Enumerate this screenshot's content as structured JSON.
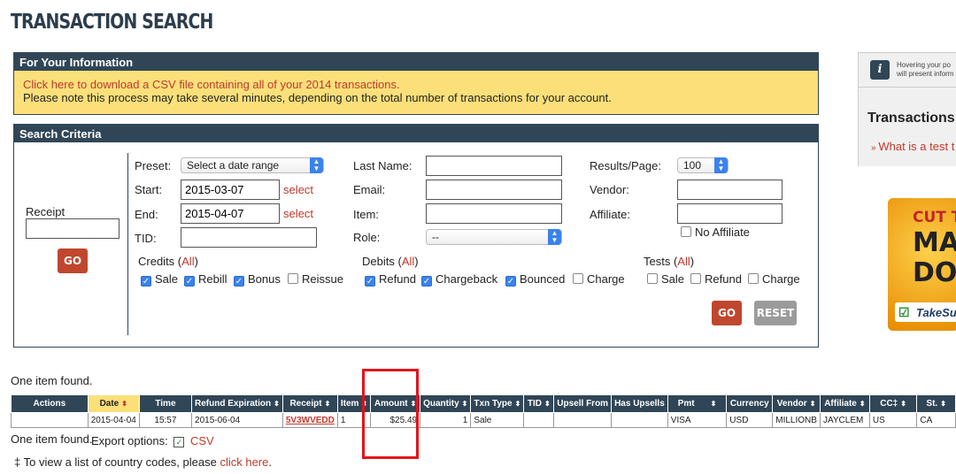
{
  "page": {
    "title": "TRANSACTION SEARCH"
  },
  "info": {
    "header": "For Your Information",
    "csv_link": "Click here to download a CSV file containing all of your 2014 transactions.",
    "note": "Please note this process may take several minutes, depending on the total number of transactions for your account."
  },
  "criteria": {
    "header": "Search Criteria",
    "receipt_label": "Receipt",
    "go_label": "GO",
    "reset_label": "RESET",
    "preset_label": "Preset:",
    "preset_value": "Select a date range",
    "start_label": "Start:",
    "start_value": "2015-03-07",
    "end_label": "End:",
    "end_value": "2015-04-07",
    "select_link": "select",
    "tid_label": "TID:",
    "last_name_label": "Last Name:",
    "email_label": "Email:",
    "item_label": "Item:",
    "role_label": "Role:",
    "role_value": "--",
    "results_label": "Results/Page:",
    "results_value": "100",
    "vendor_label": "Vendor:",
    "affiliate_label": "Affiliate:",
    "no_affiliate_label": "No Affiliate",
    "all_label": "All",
    "credits": {
      "label": "Credits",
      "sale": "Sale",
      "rebill": "Rebill",
      "bonus": "Bonus",
      "reissue": "Reissue"
    },
    "debits": {
      "label": "Debits",
      "refund": "Refund",
      "chargeback": "Chargeback",
      "bounced": "Bounced",
      "charge": "Charge"
    },
    "tests": {
      "label": "Tests",
      "sale": "Sale",
      "refund": "Refund",
      "charge": "Charge"
    }
  },
  "results": {
    "found_text": "One item found.",
    "headers": [
      "Actions",
      "Date",
      "Time",
      "Refund Expiration",
      "Receipt",
      "Item",
      "Amount",
      "Quantity",
      "Txn Type",
      "TID",
      "Upsell From",
      "Has Upsells",
      "Pmt",
      "Currency",
      "Vendor",
      "Affiliate",
      "CC‡",
      "St."
    ],
    "row": [
      "",
      "2015-04-04",
      "15:57",
      "2015-06-04",
      "5V3WVEDD",
      "1",
      "$25.49",
      "1",
      "Sale",
      "",
      "",
      "",
      "VISA",
      "USD",
      "MILLIONB",
      "JAYCLEM",
      "US",
      "CA"
    ],
    "export_label": "Export options:",
    "csv_label": "CSV",
    "footnote_prefix": "‡ To view a list of country codes, please ",
    "footnote_link": "click here",
    "footnote_suffix": "."
  },
  "sidebar": {
    "hover_text_1": "Hovering your po",
    "hover_text_2": "will present inform",
    "transactions_title": "Transactions",
    "test_link": "What is a test t",
    "ad_line1": "CUT T",
    "ad_line2": "MA",
    "ad_line3": "DOL",
    "ad_brand": "TakeSu"
  }
}
